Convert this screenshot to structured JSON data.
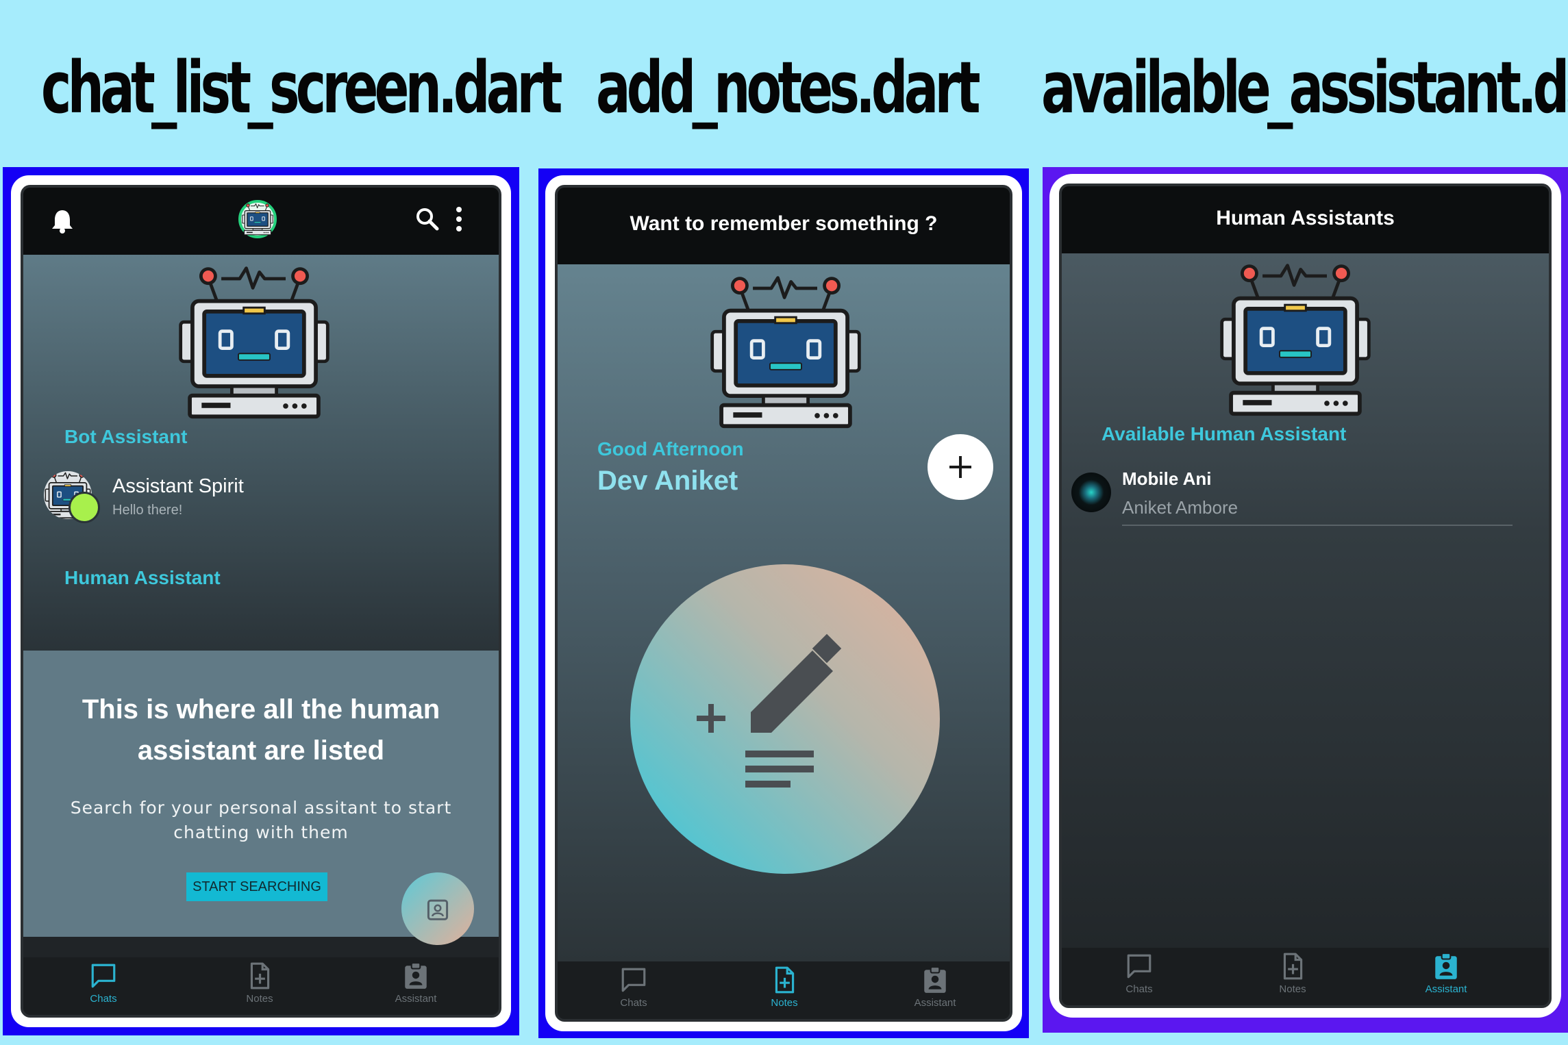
{
  "titles": [
    "chat_list_screen.dart",
    "add_notes.dart",
    "available_assistant.dart"
  ],
  "colors": {
    "background": "#a6ecfc",
    "accent": "#3ec8dc",
    "frame1": "#1400f5",
    "frame2": "#1400f5",
    "frame3": "#5b17f0",
    "appbar": "#0c0e0f"
  },
  "screen1": {
    "bot_section_title": "Bot Assistant",
    "bot_name": "Assistant Spirit",
    "bot_last_message": "Hello there!",
    "human_section_title": "Human Assistant",
    "empty_heading_line1": "This is where all the human",
    "empty_heading_line2": "assistant are listed",
    "empty_sub_line1": "Search for your personal assitant to start",
    "empty_sub_line2": "chatting with them",
    "start_button": "START SEARCHING",
    "icons": {
      "left": "bell-icon",
      "center": "app-logo",
      "search": "search-icon",
      "menu": "more-vert-icon",
      "fab": "contact-badge-icon"
    }
  },
  "screen2": {
    "appbar_title": "Want to remember something ?",
    "greeting": "Good Afternoon",
    "user_name": "Dev Aniket",
    "icons": {
      "add": "plus-icon",
      "illustration": "edit-note-icon"
    }
  },
  "screen3": {
    "appbar_title": "Human Assistants",
    "section_title": "Available Human Assistant",
    "assistant_name": "Mobile Ani",
    "assistant_subtitle": "Aniket Ambore"
  },
  "nav": {
    "chats": "Chats",
    "notes": "Notes",
    "assistant": "Assistant"
  },
  "active_tabs": {
    "screen1": "Chats",
    "screen2": "Notes",
    "screen3": "Assistant"
  }
}
